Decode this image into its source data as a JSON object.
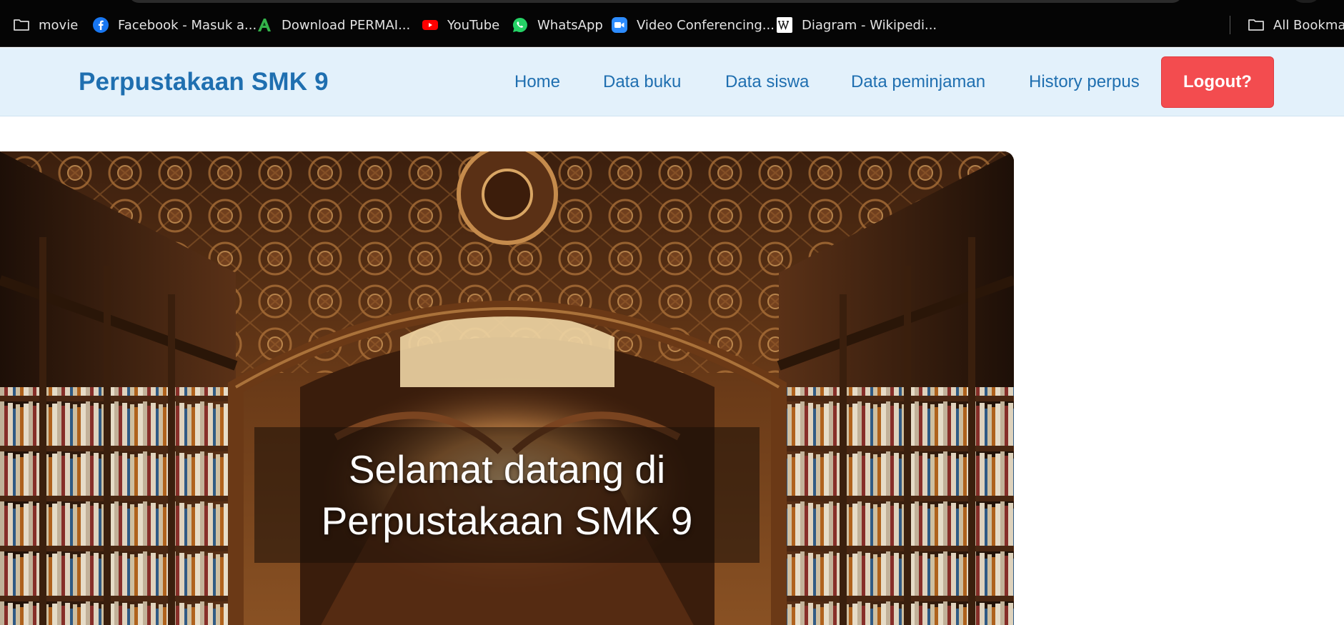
{
  "bookmarks": [
    {
      "label": "movie",
      "icon": "folder-icon"
    },
    {
      "label": "Facebook - Masuk a...",
      "icon": "facebook-icon"
    },
    {
      "label": "Download PERMAI...",
      "icon": "permai-icon"
    },
    {
      "label": "YouTube",
      "icon": "youtube-icon"
    },
    {
      "label": "WhatsApp",
      "icon": "whatsapp-icon"
    },
    {
      "label": "Video Conferencing...",
      "icon": "zoom-video-icon"
    },
    {
      "label": "Diagram - Wikipedi...",
      "icon": "wikipedia-icon"
    },
    {
      "label": "All Bookmar",
      "icon": "folder-icon"
    }
  ],
  "navbar": {
    "brand": "Perpustakaan SMK 9",
    "links": [
      "Home",
      "Data buku",
      "Data siswa",
      "Data peminjaman",
      "History perpus"
    ],
    "logout_label": "Logout?"
  },
  "hero": {
    "line1": "Selamat datang di",
    "line2": "Perpustakaan SMK 9"
  },
  "colors": {
    "brand": "#1f6fb0",
    "navbar_bg": "#e3f1fb",
    "logout_bg": "#f34c4f",
    "bookmarks_bg": "#050505"
  }
}
